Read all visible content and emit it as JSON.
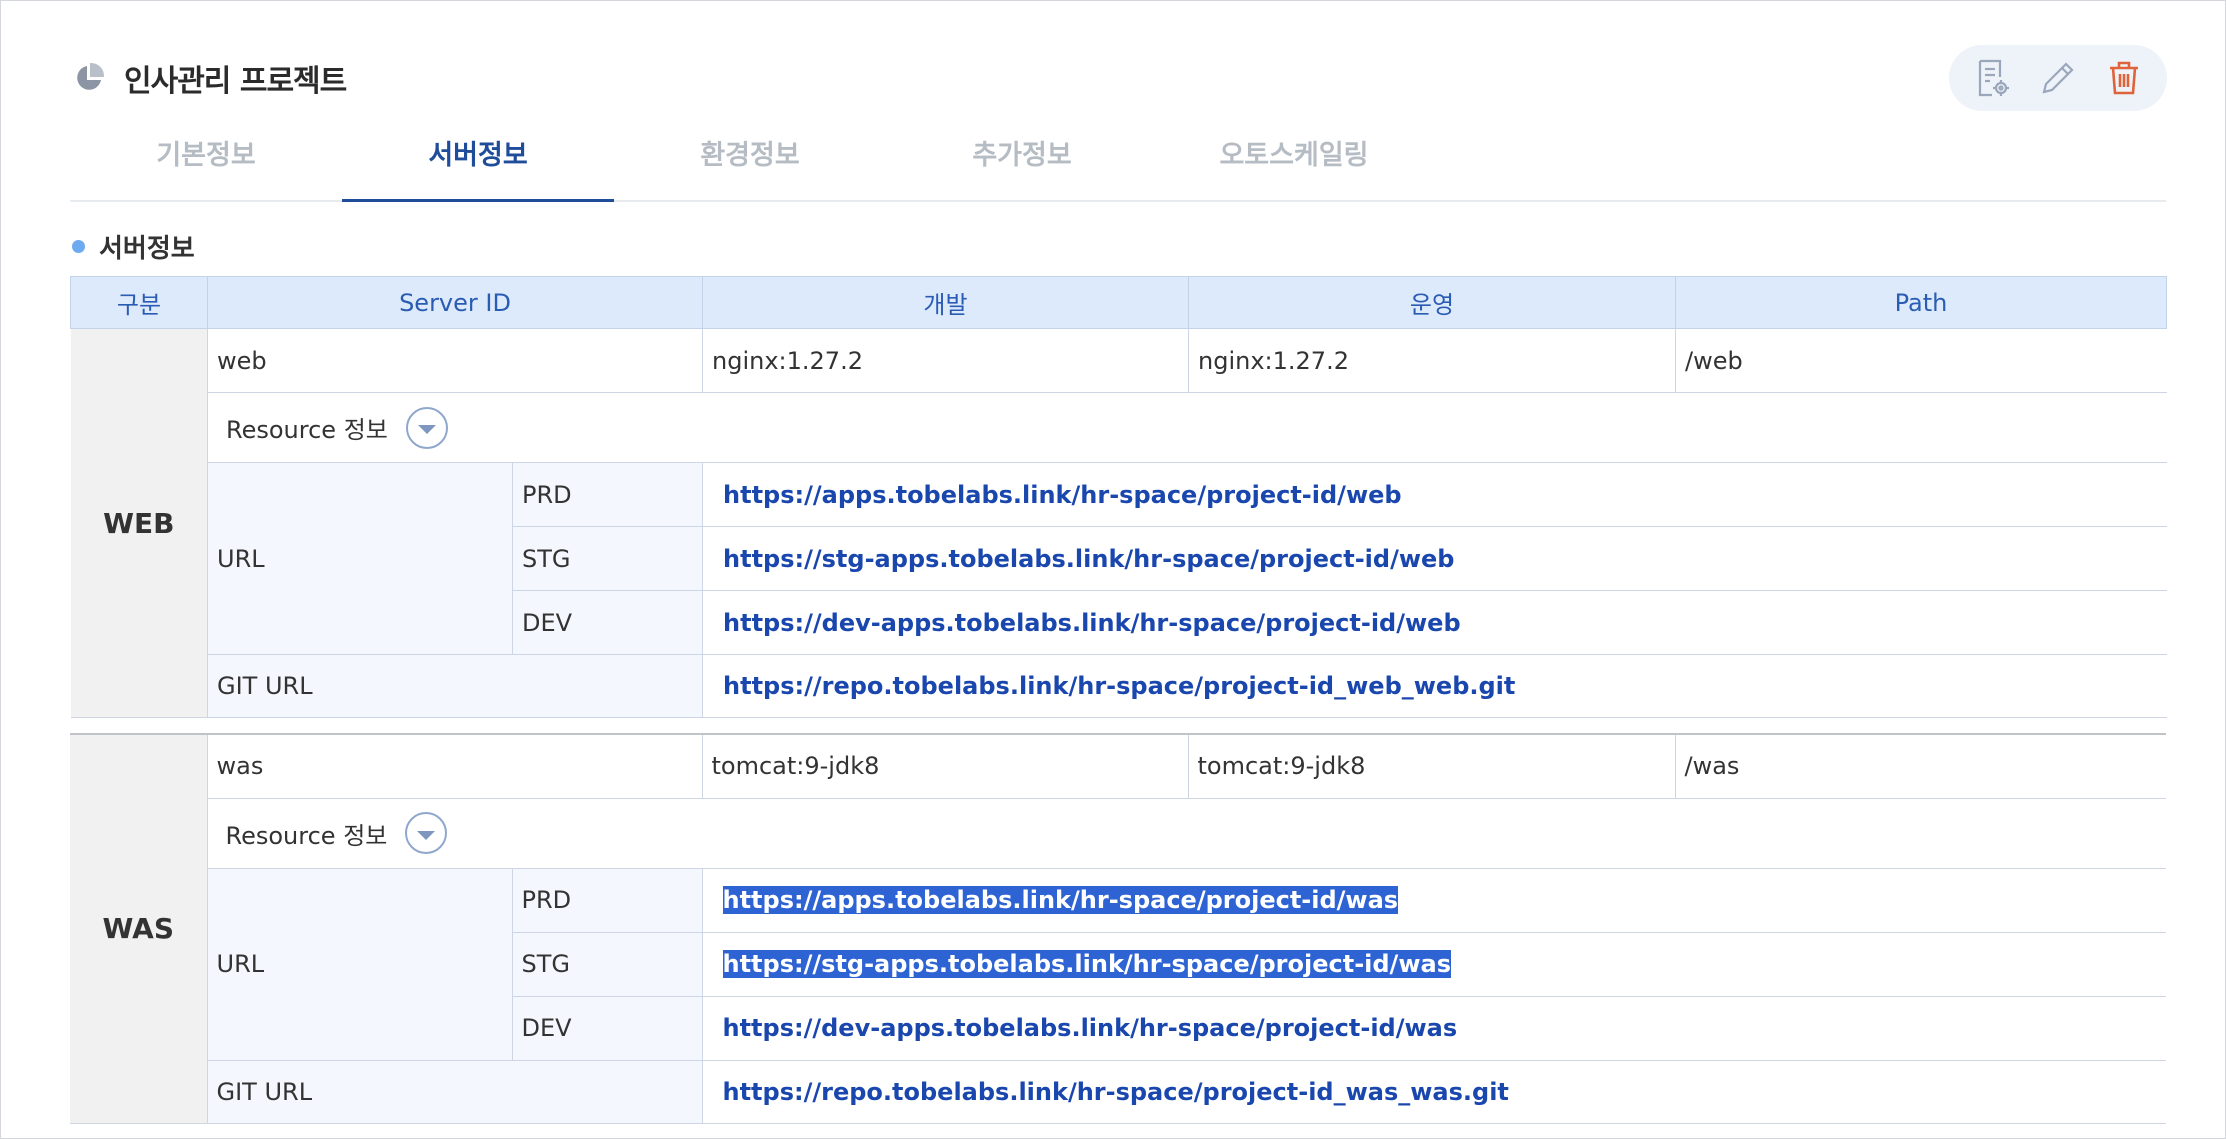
{
  "header": {
    "title": "인사관리 프로젝트",
    "icon": "pie-chart-icon"
  },
  "actions": {
    "icons": [
      "settings-doc-icon",
      "edit-icon",
      "delete-icon"
    ],
    "delete_color": "#e0643a"
  },
  "tabs": [
    {
      "label": "기본정보",
      "active": false
    },
    {
      "label": "서버정보",
      "active": true
    },
    {
      "label": "환경정보",
      "active": false
    },
    {
      "label": "추가정보",
      "active": false
    },
    {
      "label": "오토스케일링",
      "active": false
    }
  ],
  "section": {
    "title": "서버정보"
  },
  "table": {
    "headers": {
      "gubun": "구분",
      "server_id": "Server ID",
      "dev": "개발",
      "ops": "운영",
      "path": "Path"
    }
  },
  "groups": [
    {
      "name": "WEB",
      "server_id": "web",
      "dev": "nginx:1.27.2",
      "ops": "nginx:1.27.2",
      "path": "/web",
      "resource_label": "Resource 정보",
      "url_label": "URL",
      "urls": [
        {
          "env": "PRD",
          "url": "https://apps.tobelabs.link/hr-space/project-id/web"
        },
        {
          "env": "STG",
          "url": "https://stg-apps.tobelabs.link/hr-space/project-id/web"
        },
        {
          "env": "DEV",
          "url": "https://dev-apps.tobelabs.link/hr-space/project-id/web"
        }
      ],
      "git_label": "GIT URL",
      "git_url": "https://repo.tobelabs.link/hr-space/project-id_web_web.git"
    },
    {
      "name": "WAS",
      "server_id": "was",
      "dev": "tomcat:9-jdk8",
      "ops": "tomcat:9-jdk8",
      "path": "/was",
      "resource_label": "Resource 정보",
      "url_label": "URL",
      "urls": [
        {
          "env": "PRD",
          "url": "https://apps.tobelabs.link/hr-space/project-id/was"
        },
        {
          "env": "STG",
          "url": "https://stg-apps.tobelabs.link/hr-space/project-id/was"
        },
        {
          "env": "DEV",
          "url": "https://dev-apps.tobelabs.link/hr-space/project-id/was"
        }
      ],
      "git_label": "GIT URL",
      "git_url": "https://repo.tobelabs.link/hr-space/project-id_was_was.git"
    }
  ]
}
